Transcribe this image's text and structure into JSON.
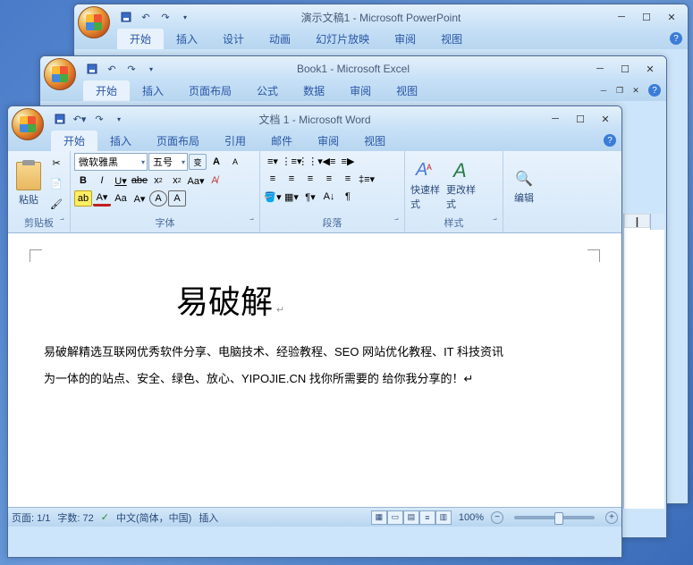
{
  "powerpoint": {
    "title": "演示文稿1 - Microsoft PowerPoint",
    "tabs": [
      "开始",
      "插入",
      "设计",
      "动画",
      "幻灯片放映",
      "审阅",
      "视图"
    ]
  },
  "excel": {
    "title": "Book1 - Microsoft Excel",
    "tabs": [
      "开始",
      "插入",
      "页面布局",
      "公式",
      "数据",
      "审阅",
      "视图"
    ],
    "col_header": "I"
  },
  "word": {
    "title": "文档 1 - Microsoft Word",
    "tabs": [
      "开始",
      "插入",
      "页面布局",
      "引用",
      "邮件",
      "审阅",
      "视图"
    ],
    "clipboard": {
      "paste": "粘贴",
      "label": "剪贴板"
    },
    "font": {
      "name": "微软雅黑",
      "size": "五号",
      "label": "字体"
    },
    "para": {
      "label": "段落"
    },
    "styles": {
      "quick": "快速样式",
      "change": "更改样式",
      "label": "样式"
    },
    "editing": {
      "label": "编辑"
    },
    "doc": {
      "heading": "易破解",
      "p1": "易破解精选互联网优秀软件分享、电脑技术、经验教程、SEO 网站优化教程、IT 科技资讯",
      "p2": "为一体的的站点、安全、绿色、放心、YIPOJIE.CN 找你所需要的 给你我分享的！↵"
    },
    "status": {
      "page": "页面: 1/1",
      "words": "字数: 72",
      "lang": "中文(简体，中国)",
      "mode": "插入",
      "zoom": "100%"
    }
  }
}
